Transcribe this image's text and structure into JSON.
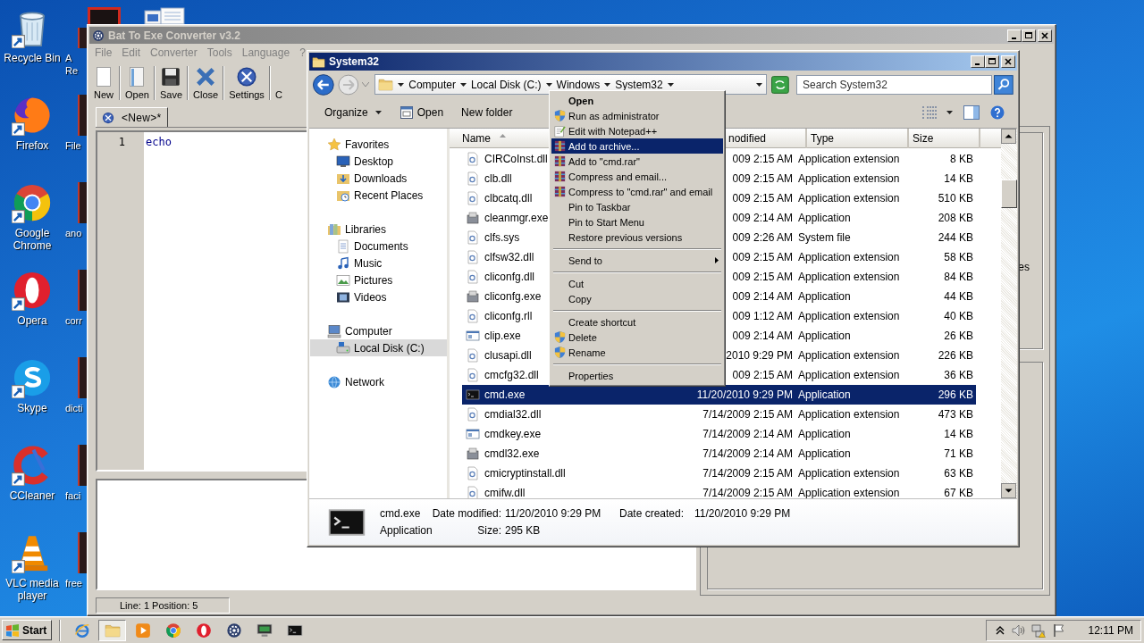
{
  "desktop": {
    "icons": [
      {
        "label": "Recycle Bin",
        "kind": "bin"
      },
      {
        "label": "Firefox",
        "kind": "fox"
      },
      {
        "label": "Google Chrome",
        "kind": "chrome"
      },
      {
        "label": "Opera",
        "kind": "opera"
      },
      {
        "label": "Skype",
        "kind": "skype"
      },
      {
        "label": "CCleaner",
        "kind": "ccleaner"
      },
      {
        "label": "VLC media player",
        "kind": "cone"
      }
    ],
    "partial_icons": [
      {
        "label": "A Re"
      },
      {
        "label": "File"
      },
      {
        "label": "ano"
      },
      {
        "label": "corr"
      },
      {
        "label": "dicti"
      },
      {
        "label": "faci"
      },
      {
        "label": "free"
      }
    ]
  },
  "bat_window": {
    "title": "Bat To Exe Converter v3.2",
    "menu": [
      "File",
      "Edit",
      "Converter",
      "Tools",
      "Language",
      "?"
    ],
    "toolbar": [
      {
        "label": "New",
        "kind": "new"
      },
      {
        "label": "Open",
        "kind": "open"
      },
      {
        "label": "Save",
        "kind": "save"
      },
      {
        "label": "Close",
        "kind": "close"
      },
      {
        "label": "Settings",
        "kind": "settings"
      },
      {
        "label": "C",
        "kind": "partial"
      }
    ],
    "tab": {
      "label": "<New>*",
      "selected": true
    },
    "editor": {
      "lines": [
        {
          "number": "1",
          "code": "echo"
        }
      ]
    },
    "side_text": "es",
    "status": "Line: 1 Position: 5"
  },
  "explorer": {
    "title": "System32",
    "breadcrumb": [
      "Computer",
      "Local Disk (C:)",
      "Windows",
      "System32"
    ],
    "search": {
      "placeholder": "Search System32"
    },
    "commands": [
      {
        "label": "Organize",
        "kind": "menu"
      },
      {
        "label": "Open",
        "kind": "open"
      },
      {
        "label": "New folder",
        "kind": "plain"
      }
    ],
    "nav": [
      {
        "label": "Favorites",
        "kind": "star",
        "selected": false,
        "children": [
          {
            "label": "Desktop",
            "kind": "desktop",
            "selected": false
          },
          {
            "label": "Downloads",
            "kind": "download",
            "selected": false
          },
          {
            "label": "Recent Places",
            "kind": "recent",
            "selected": false
          }
        ]
      },
      {
        "label": "Libraries",
        "kind": "library",
        "selected": false,
        "children": [
          {
            "label": "Documents",
            "kind": "documents",
            "selected": false
          },
          {
            "label": "Music",
            "kind": "music",
            "selected": false
          },
          {
            "label": "Pictures",
            "kind": "pictures",
            "selected": false
          },
          {
            "label": "Videos",
            "kind": "videos",
            "selected": false
          }
        ]
      },
      {
        "label": "Computer",
        "kind": "computer",
        "selected": false,
        "children": [
          {
            "label": "Local Disk (C:)",
            "kind": "disk",
            "selected": true
          }
        ]
      },
      {
        "label": "Network",
        "kind": "network",
        "selected": false
      }
    ],
    "columns": [
      {
        "label": "Name",
        "sorted": true
      },
      {
        "label": "nodified",
        "sorted": false
      },
      {
        "label": "Type",
        "sorted": false
      },
      {
        "label": "Size",
        "sorted": false
      }
    ],
    "rows": [
      {
        "name": "CIRCoInst.dll",
        "kind": "dll",
        "modified": "009 2:15 AM",
        "type": "Application extension",
        "size": "8 KB",
        "selected": false
      },
      {
        "name": "clb.dll",
        "kind": "dll",
        "modified": "009 2:15 AM",
        "type": "Application extension",
        "size": "14 KB",
        "selected": false
      },
      {
        "name": "clbcatq.dll",
        "kind": "dll",
        "modified": "009 2:15 AM",
        "type": "Application extension",
        "size": "510 KB",
        "selected": false
      },
      {
        "name": "cleanmgr.exe",
        "kind": "setup",
        "modified": "009 2:14 AM",
        "type": "Application",
        "size": "208 KB",
        "selected": false
      },
      {
        "name": "clfs.sys",
        "kind": "dll",
        "modified": "009 2:26 AM",
        "type": "System file",
        "size": "244 KB",
        "selected": false
      },
      {
        "name": "clfsw32.dll",
        "kind": "dll",
        "modified": "009 2:15 AM",
        "type": "Application extension",
        "size": "58 KB",
        "selected": false
      },
      {
        "name": "cliconfg.dll",
        "kind": "dll",
        "modified": "009 2:15 AM",
        "type": "Application extension",
        "size": "84 KB",
        "selected": false
      },
      {
        "name": "cliconfg.exe",
        "kind": "setup",
        "modified": "009 2:14 AM",
        "type": "Application",
        "size": "44 KB",
        "selected": false
      },
      {
        "name": "cliconfg.rll",
        "kind": "dll",
        "modified": "009 1:12 AM",
        "type": "Application extension",
        "size": "40 KB",
        "selected": false
      },
      {
        "name": "clip.exe",
        "kind": "app",
        "modified": "009 2:14 AM",
        "type": "Application",
        "size": "26 KB",
        "selected": false
      },
      {
        "name": "clusapi.dll",
        "kind": "dll",
        "modified": "2010 9:29 PM",
        "type": "Application extension",
        "size": "226 KB",
        "selected": false
      },
      {
        "name": "cmcfg32.dll",
        "kind": "dll",
        "modified": "009 2:15 AM",
        "type": "Application extension",
        "size": "36 KB",
        "selected": false
      },
      {
        "name": "cmd.exe",
        "kind": "cmd",
        "modified": "11/20/2010 9:29 PM",
        "type": "Application",
        "size": "296 KB",
        "selected": true
      },
      {
        "name": "cmdial32.dll",
        "kind": "dll",
        "modified": "7/14/2009 2:15 AM",
        "type": "Application extension",
        "size": "473 KB",
        "selected": false
      },
      {
        "name": "cmdkey.exe",
        "kind": "app",
        "modified": "7/14/2009 2:14 AM",
        "type": "Application",
        "size": "14 KB",
        "selected": false
      },
      {
        "name": "cmdl32.exe",
        "kind": "setup",
        "modified": "7/14/2009 2:14 AM",
        "type": "Application",
        "size": "71 KB",
        "selected": false
      },
      {
        "name": "cmicryptinstall.dll",
        "kind": "dll",
        "modified": "7/14/2009 2:15 AM",
        "type": "Application extension",
        "size": "63 KB",
        "selected": false
      },
      {
        "name": "cmifw.dll",
        "kind": "dll",
        "modified": "7/14/2009 2:15 AM",
        "type": "Application extension",
        "size": "67 KB",
        "selected": false
      }
    ],
    "details": {
      "name": "cmd.exe",
      "type": "Application",
      "modified_label": "Date modified:",
      "modified": "11/20/2010 9:29 PM",
      "created_label": "Date created:",
      "created": "11/20/2010 9:29 PM",
      "size_label": "Size:",
      "size": "295 KB"
    }
  },
  "context_menu": [
    {
      "kind": "plain",
      "label": "Open",
      "default": true,
      "selected": false,
      "submenu": false
    },
    {
      "kind": "shield",
      "label": "Run as administrator",
      "default": false,
      "selected": false,
      "submenu": false
    },
    {
      "kind": "notepad",
      "label": "Edit with Notepad++",
      "default": false,
      "selected": false,
      "submenu": false
    },
    {
      "kind": "archive",
      "label": "Add to archive...",
      "default": false,
      "selected": true,
      "submenu": false
    },
    {
      "kind": "archive",
      "label": "Add to \"cmd.rar\"",
      "default": false,
      "selected": false,
      "submenu": false
    },
    {
      "kind": "archive",
      "label": "Compress and email...",
      "default": false,
      "selected": false,
      "submenu": false
    },
    {
      "kind": "archive",
      "label": "Compress to \"cmd.rar\" and email",
      "default": false,
      "selected": false,
      "submenu": false
    },
    {
      "kind": "plain",
      "label": "Pin to Taskbar",
      "default": false,
      "selected": false,
      "submenu": false
    },
    {
      "kind": "plain",
      "label": "Pin to Start Menu",
      "default": false,
      "selected": false,
      "submenu": false
    },
    {
      "kind": "plain",
      "label": "Restore previous versions",
      "default": false,
      "selected": false,
      "submenu": false
    },
    {
      "kind": "separator"
    },
    {
      "kind": "plain",
      "label": "Send to",
      "default": false,
      "selected": false,
      "submenu": true
    },
    {
      "kind": "separator"
    },
    {
      "kind": "plain",
      "label": "Cut",
      "default": false,
      "selected": false,
      "submenu": false
    },
    {
      "kind": "plain",
      "label": "Copy",
      "default": false,
      "selected": false,
      "submenu": false
    },
    {
      "kind": "separator"
    },
    {
      "kind": "plain",
      "label": "Create shortcut",
      "default": false,
      "selected": false,
      "submenu": false
    },
    {
      "kind": "shield",
      "label": "Delete",
      "default": false,
      "selected": false,
      "submenu": false
    },
    {
      "kind": "shield",
      "label": "Rename",
      "default": false,
      "selected": false,
      "submenu": false
    },
    {
      "kind": "separator"
    },
    {
      "kind": "plain",
      "label": "Properties",
      "default": false,
      "selected": false,
      "submenu": false
    }
  ],
  "taskbar": {
    "start": "Start",
    "apps": [
      {
        "kind": "ie",
        "active": false
      },
      {
        "kind": "folder",
        "active": true
      },
      {
        "kind": "media",
        "active": false
      },
      {
        "kind": "chrome",
        "active": false
      },
      {
        "kind": "opera",
        "active": false
      },
      {
        "kind": "gear",
        "active": false
      },
      {
        "kind": "monitor",
        "active": false
      },
      {
        "kind": "console",
        "active": false
      }
    ],
    "clock": "12:11 PM"
  }
}
